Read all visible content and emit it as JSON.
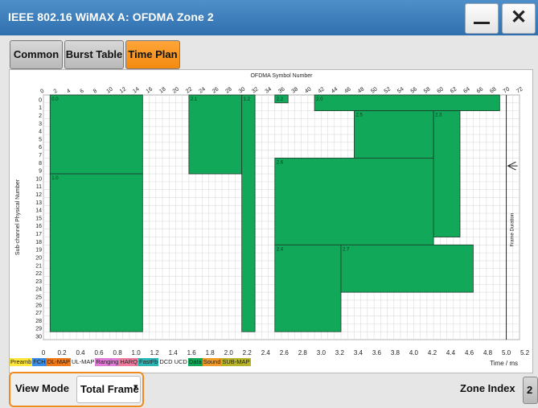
{
  "window": {
    "title": "IEEE 802.16 WiMAX A: OFDMA Zone 2",
    "minimize_icon": "minimize-icon",
    "close_label": "✕"
  },
  "tabs": [
    {
      "label": "Common",
      "active": false
    },
    {
      "label": "Burst Table",
      "active": false
    },
    {
      "label": "Time Plan",
      "active": true
    }
  ],
  "colors": {
    "accent": "#f38a10",
    "burst": "#11a85a",
    "title_bar": "#3d7dbd"
  },
  "chart_data": {
    "type": "time-plan",
    "title": "OFDMA Symbol Number",
    "xlabel_top": "OFDMA Symbol Number",
    "xlabel_bottom": "Time / ms",
    "ylabel": "Sub-channel Physical Number",
    "frame_label": "Frame Duration",
    "x_ticks_top": [
      "0",
      "2",
      "4",
      "6",
      "8",
      "10",
      "12",
      "14",
      "16",
      "18",
      "20",
      "22",
      "24",
      "26",
      "28",
      "30",
      "32",
      "34",
      "36",
      "38",
      "40",
      "42",
      "44",
      "46",
      "48",
      "50",
      "52",
      "54",
      "56",
      "58",
      "60",
      "62",
      "64",
      "66",
      "68",
      "70",
      "72"
    ],
    "x_ticks_bottom": [
      "0",
      "0.2",
      "0.4",
      "0.6",
      "0.8",
      "1.0",
      "1.2",
      "1.4",
      "1.6",
      "1.8",
      "2.0",
      "2.2",
      "2.4",
      "2.6",
      "2.8",
      "3.0",
      "3.2",
      "3.4",
      "3.6",
      "3.8",
      "4.0",
      "4.2",
      "4.4",
      "4.6",
      "4.8",
      "5.0",
      "5.2"
    ],
    "y_ticks": [
      "0",
      "1",
      "2",
      "3",
      "4",
      "5",
      "6",
      "7",
      "8",
      "9",
      "10",
      "11",
      "12",
      "13",
      "14",
      "15",
      "16",
      "17",
      "18",
      "19",
      "20",
      "21",
      "22",
      "23",
      "24",
      "25",
      "26",
      "27",
      "28",
      "29",
      "30"
    ],
    "xlim": [
      0,
      72
    ],
    "ylim": [
      0,
      30
    ],
    "frame_duration_symbol": 70,
    "bursts": [
      {
        "label": "0.0",
        "x0": 1,
        "x1": 15,
        "y0": 0,
        "y1": 10
      },
      {
        "label": "1.0",
        "x0": 1,
        "x1": 15,
        "y0": 10,
        "y1": 30
      },
      {
        "label": "2.1",
        "x0": 22,
        "x1": 30,
        "y0": 0,
        "y1": 10
      },
      {
        "label": "1.2",
        "x0": 30,
        "x1": 32,
        "y0": 0,
        "y1": 30
      },
      {
        "label": "2.2",
        "x0": 35,
        "x1": 37,
        "y0": 0,
        "y1": 1
      },
      {
        "label": "2.0",
        "x0": 41,
        "x1": 69,
        "y0": 0,
        "y1": 2
      },
      {
        "label": "2.5",
        "x0": 47,
        "x1": 59,
        "y0": 2,
        "y1": 8
      },
      {
        "label": "2.3",
        "x0": 59,
        "x1": 63,
        "y0": 2,
        "y1": 18
      },
      {
        "label": "2.6",
        "x0": 35,
        "x1": 59,
        "y0": 8,
        "y1": 19
      },
      {
        "label": "2.4",
        "x0": 35,
        "x1": 45,
        "y0": 19,
        "y1": 30
      },
      {
        "label": "2.7",
        "x0": 45,
        "x1": 65,
        "y0": 19,
        "y1": 25
      }
    ],
    "grid": true
  },
  "legend": [
    {
      "label": "Preamb",
      "color": "#ffe63a"
    },
    {
      "label": "FCH",
      "color": "#3a8ee6"
    },
    {
      "label": "DL-MAP",
      "color": "#f07a1a"
    },
    {
      "label": "UL-MAP",
      "color": "#ffffff"
    },
    {
      "label": "Ranging",
      "color": "#e27ad8"
    },
    {
      "label": "HARQ",
      "color": "#f07a9e"
    },
    {
      "label": "FastFb",
      "color": "#2bb6b6"
    },
    {
      "label": "DCD",
      "color": "#ffffff"
    },
    {
      "label": "UCD",
      "color": "#ffffff"
    },
    {
      "label": "Data",
      "color": "#11a85a"
    },
    {
      "label": "Sound",
      "color": "#f09a2a"
    },
    {
      "label": "SUB-MAP",
      "color": "#b7b42a"
    }
  ],
  "bottom": {
    "view_mode_label": "View Mode",
    "view_mode_value": "Total Frame",
    "zone_index_label": "Zone Index",
    "zone_index_value": "2"
  }
}
